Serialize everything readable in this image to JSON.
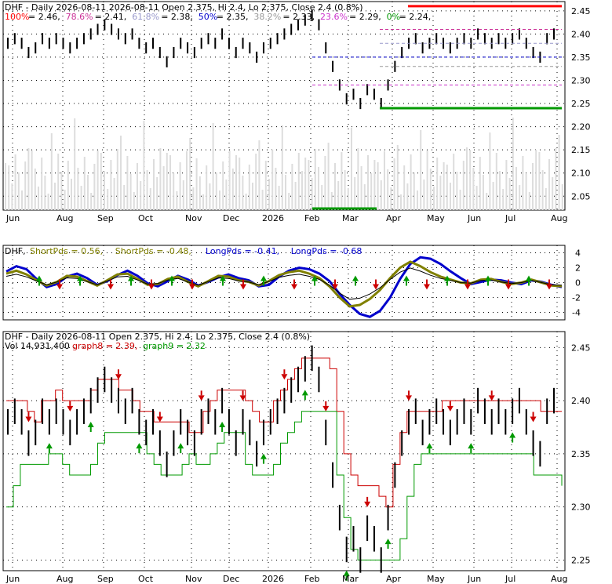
{
  "chart_data": [
    {
      "type": "line",
      "title": "DHF - Daily 2026-08-11 Open 2.375, Hi 2.4, Lo 2.375, Close 2.4 (0.8%)",
      "x_tick_labels": [
        "Jun",
        "Aug",
        "Sep",
        "Oct",
        "Nov",
        "Dec",
        "2026",
        "Feb",
        "Mar",
        "Apr",
        "May",
        "Jun",
        "Jul",
        "Aug"
      ],
      "y_tick_labels": [
        "2.45",
        "2.40",
        "2.35",
        "2.30",
        "2.25",
        "2.20",
        "2.15",
        "2.10",
        "2.05"
      ],
      "ylim": [
        2.02,
        2.47
      ],
      "fibonacci_levels": [
        {
          "label": "100%",
          "value": "2.46",
          "color": "#ff0000"
        },
        {
          "label": "78.6%",
          "value": "2.41",
          "color": "#cc3399"
        },
        {
          "label": "61.8%",
          "value": "2.38",
          "color": "#9999cc"
        },
        {
          "label": "50%",
          "value": "2.35",
          "color": "#0000cc"
        },
        {
          "label": "38.2%",
          "value": "2.33",
          "color": "#999999"
        },
        {
          "label": "23.6%",
          "value": "2.29",
          "color": "#cc33cc"
        },
        {
          "label": "0%",
          "value": "2.24",
          "color": "#009900"
        }
      ],
      "close_series": [
        2.38,
        2.39,
        2.38,
        2.36,
        2.37,
        2.39,
        2.38,
        2.39,
        2.38,
        2.37,
        2.38,
        2.39,
        2.4,
        2.41,
        2.42,
        2.41,
        2.4,
        2.39,
        2.4,
        2.38,
        2.37,
        2.38,
        2.36,
        2.34,
        2.36,
        2.38,
        2.37,
        2.36,
        2.38,
        2.39,
        2.38,
        2.4,
        2.38,
        2.36,
        2.38,
        2.37,
        2.35,
        2.37,
        2.38,
        2.39,
        2.4,
        2.41,
        2.42,
        2.43,
        2.44,
        2.42,
        2.37,
        2.33,
        2.29,
        2.26,
        2.27,
        2.25,
        2.28,
        2.27,
        2.25,
        2.29,
        2.33,
        2.36,
        2.38,
        2.39,
        2.37,
        2.38,
        2.39,
        2.38,
        2.37,
        2.38,
        2.39,
        2.38,
        2.4,
        2.39,
        2.38,
        2.39,
        2.38,
        2.39,
        2.4,
        2.38,
        2.36,
        2.35,
        2.39,
        2.4
      ],
      "volume_label": "Vol 14,931,400"
    },
    {
      "type": "line",
      "title": "DHF - ShortPds = 0.56, ShortPds = -0.48, LongPds = -0.41, LongPds = -0.68",
      "legend": [
        {
          "name": "DHF",
          "color": "#000000"
        },
        {
          "name": "ShortPds = 0.56",
          "color": "#808000"
        },
        {
          "name": "ShortPds = -0.48",
          "color": "#808000"
        },
        {
          "name": "LongPds = -0.41",
          "color": "#0000cc"
        },
        {
          "name": "LongPds = -0.68",
          "color": "#0000cc"
        }
      ],
      "y_tick_labels": [
        "4",
        "2",
        "0",
        "-2",
        "-4"
      ],
      "ylim": [
        -5,
        5
      ],
      "long_series": [
        1.5,
        2.2,
        1.8,
        0.5,
        -0.6,
        -0.2,
        0.8,
        1.2,
        0.6,
        -0.3,
        0.2,
        1.0,
        1.6,
        0.9,
        -0.1,
        -0.5,
        0.2,
        0.9,
        0.4,
        -0.4,
        0.1,
        0.7,
        1.1,
        0.6,
        0.3,
        -0.5,
        -0.3,
        0.8,
        1.6,
        2.0,
        1.8,
        1.2,
        0.2,
        -1.5,
        -3.0,
        -4.2,
        -4.6,
        -3.8,
        -2.0,
        0.5,
        2.5,
        3.4,
        3.2,
        2.5,
        1.5,
        0.6,
        -0.2,
        0.1,
        0.4,
        0.3,
        0.0,
        -0.2,
        0.3,
        0.1,
        -0.3,
        -0.6
      ],
      "short_series": [
        1.2,
        1.6,
        1.1,
        0.3,
        -0.4,
        0.1,
        0.9,
        0.8,
        0.2,
        -0.4,
        0.3,
        1.1,
        1.2,
        0.5,
        -0.3,
        -0.2,
        0.5,
        0.8,
        0.1,
        -0.5,
        0.2,
        0.9,
        0.8,
        0.3,
        0.1,
        -0.4,
        0.2,
        1.0,
        1.4,
        1.6,
        1.2,
        0.6,
        -0.5,
        -2.0,
        -3.2,
        -3.0,
        -2.2,
        -1.0,
        0.6,
        2.0,
        2.8,
        2.2,
        1.4,
        0.8,
        0.4,
        0.0,
        -0.1,
        0.4,
        0.5,
        0.1,
        -0.2,
        0.0,
        0.4,
        0.0,
        -0.4,
        -0.48
      ]
    },
    {
      "type": "line",
      "title": "DHF - Daily 2026-08-11 Open 2.375, Hi 2.4, Lo 2.375, Close 2.4 (0.8%)",
      "subtitle": "Vol 14,931,400",
      "legend": [
        {
          "name": "graph8 = 2.39",
          "color": "#cc0000"
        },
        {
          "name": "graph9 = 2.32",
          "color": "#009900"
        }
      ],
      "x_tick_labels": [
        "Jun",
        "Aug",
        "Sep",
        "Oct",
        "Nov",
        "Dec",
        "2026",
        "Feb",
        "Mar",
        "Apr",
        "May",
        "Jun",
        "Jul",
        "Aug"
      ],
      "y_tick_labels": [
        "2.45",
        "2.40",
        "2.35",
        "2.30",
        "2.25"
      ],
      "ylim": [
        2.24,
        2.465
      ],
      "close_series": [
        2.38,
        2.39,
        2.38,
        2.36,
        2.37,
        2.39,
        2.38,
        2.39,
        2.38,
        2.37,
        2.38,
        2.39,
        2.4,
        2.41,
        2.42,
        2.41,
        2.4,
        2.39,
        2.4,
        2.38,
        2.37,
        2.38,
        2.36,
        2.34,
        2.36,
        2.38,
        2.37,
        2.36,
        2.38,
        2.39,
        2.38,
        2.4,
        2.38,
        2.36,
        2.38,
        2.37,
        2.35,
        2.37,
        2.38,
        2.39,
        2.4,
        2.41,
        2.42,
        2.43,
        2.44,
        2.42,
        2.37,
        2.33,
        2.29,
        2.26,
        2.27,
        2.25,
        2.28,
        2.27,
        2.25,
        2.29,
        2.33,
        2.36,
        2.38,
        2.39,
        2.37,
        2.38,
        2.39,
        2.38,
        2.37,
        2.38,
        2.39,
        2.38,
        2.4,
        2.39,
        2.38,
        2.39,
        2.38,
        2.39,
        2.4,
        2.38,
        2.36,
        2.35,
        2.39,
        2.4
      ],
      "upper_series": [
        2.4,
        2.4,
        2.4,
        2.39,
        2.38,
        2.4,
        2.4,
        2.41,
        2.4,
        2.4,
        2.4,
        2.4,
        2.41,
        2.42,
        2.42,
        2.42,
        2.41,
        2.41,
        2.4,
        2.39,
        2.39,
        2.38,
        2.38,
        2.38,
        2.38,
        2.38,
        2.37,
        2.37,
        2.39,
        2.4,
        2.41,
        2.41,
        2.41,
        2.41,
        2.4,
        2.39,
        2.38,
        2.38,
        2.4,
        2.41,
        2.42,
        2.43,
        2.44,
        2.44,
        2.44,
        2.44,
        2.43,
        2.39,
        2.35,
        2.33,
        2.32,
        2.32,
        2.32,
        2.31,
        2.3,
        2.34,
        2.37,
        2.39,
        2.39,
        2.39,
        2.39,
        2.39,
        2.4,
        2.4,
        2.4,
        2.4,
        2.4,
        2.4,
        2.4,
        2.4,
        2.4,
        2.4,
        2.4,
        2.4,
        2.4,
        2.4,
        2.39,
        2.39,
        2.39,
        2.39
      ],
      "lower_series": [
        2.3,
        2.32,
        2.34,
        2.34,
        2.34,
        2.34,
        2.35,
        2.35,
        2.34,
        2.33,
        2.33,
        2.33,
        2.34,
        2.36,
        2.37,
        2.37,
        2.37,
        2.37,
        2.37,
        2.37,
        2.35,
        2.34,
        2.33,
        2.33,
        2.33,
        2.34,
        2.35,
        2.34,
        2.34,
        2.35,
        2.36,
        2.37,
        2.37,
        2.37,
        2.34,
        2.33,
        2.33,
        2.33,
        2.34,
        2.36,
        2.37,
        2.38,
        2.39,
        2.39,
        2.39,
        2.39,
        2.39,
        2.33,
        2.29,
        2.26,
        2.25,
        2.25,
        2.25,
        2.25,
        2.25,
        2.25,
        2.27,
        2.31,
        2.34,
        2.35,
        2.35,
        2.35,
        2.35,
        2.35,
        2.35,
        2.35,
        2.35,
        2.35,
        2.35,
        2.35,
        2.35,
        2.35,
        2.35,
        2.35,
        2.35,
        2.33,
        2.33,
        2.33,
        2.33,
        2.32
      ]
    }
  ]
}
